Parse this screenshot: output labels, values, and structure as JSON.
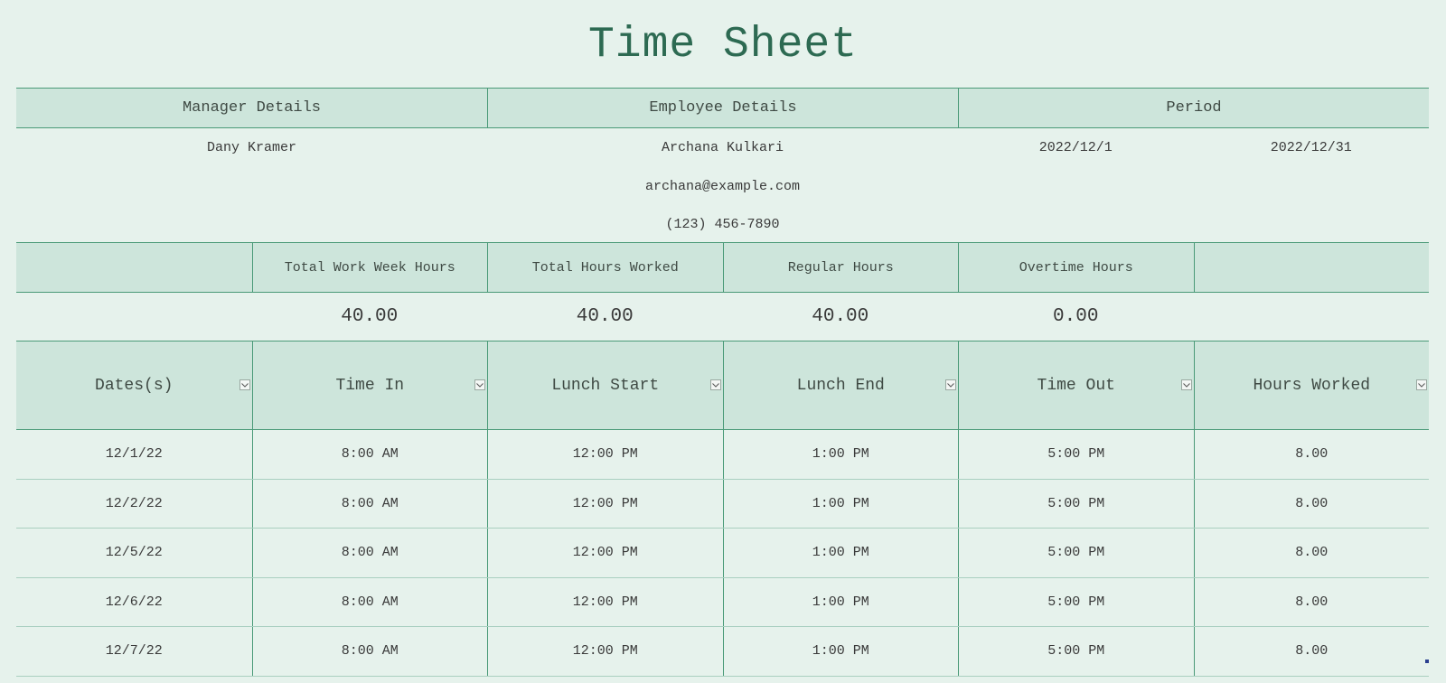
{
  "title": "Time Sheet",
  "sections": {
    "manager_label": "Manager Details",
    "employee_label": "Employee Details",
    "period_label": "Period"
  },
  "manager": {
    "name": "Dany Kramer"
  },
  "employee": {
    "name": "Archana Kulkari",
    "email": "archana@example.com",
    "phone": "(123) 456-7890"
  },
  "period": {
    "start": "2022/12/1",
    "end": "2022/12/31"
  },
  "summary": {
    "headers": [
      "",
      "Total Work Week Hours",
      "Total Hours Worked",
      "Regular Hours",
      "Overtime Hours",
      ""
    ],
    "values": [
      "",
      "40.00",
      "40.00",
      "40.00",
      "0.00",
      ""
    ]
  },
  "table": {
    "columns": [
      "Dates(s)",
      "Time In",
      "Lunch Start",
      "Lunch End",
      "Time Out",
      "Hours Worked"
    ],
    "rows": [
      [
        "12/1/22",
        "8:00 AM",
        "12:00 PM",
        "1:00 PM",
        "5:00 PM",
        "8.00"
      ],
      [
        "12/2/22",
        "8:00 AM",
        "12:00 PM",
        "1:00 PM",
        "5:00 PM",
        "8.00"
      ],
      [
        "12/5/22",
        "8:00 AM",
        "12:00 PM",
        "1:00 PM",
        "5:00 PM",
        "8.00"
      ],
      [
        "12/6/22",
        "8:00 AM",
        "12:00 PM",
        "1:00 PM",
        "5:00 PM",
        "8.00"
      ],
      [
        "12/7/22",
        "8:00 AM",
        "12:00 PM",
        "1:00 PM",
        "5:00 PM",
        "8.00"
      ]
    ]
  },
  "icons": {
    "filter": "filter-dropdown-icon"
  },
  "colors": {
    "background": "#e6f2ec",
    "header_fill": "#cde5db",
    "border": "#4a9a78",
    "title": "#2d6a52"
  }
}
